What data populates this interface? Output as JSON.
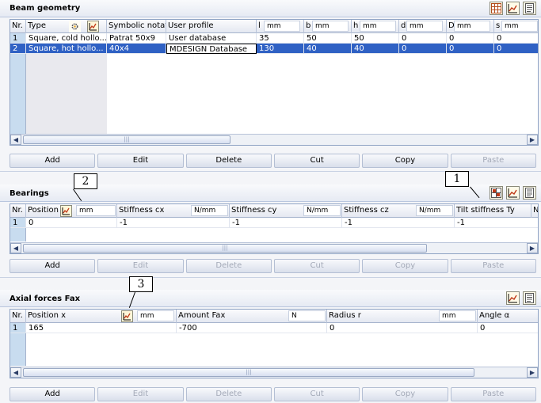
{
  "beam_geometry": {
    "title": "Beam geometry",
    "columns": {
      "nr": "Nr.",
      "type": "Type",
      "symbolic": "Symbolic notati",
      "user_profile": "User profile",
      "l": "l",
      "l_unit": "mm",
      "b": "b",
      "b_unit": "mm",
      "h": "h",
      "h_unit": "mm",
      "d": "d",
      "d_unit": "mm",
      "D": "D",
      "D_unit": "mm",
      "s": "s",
      "s_unit": "mm"
    },
    "rows": [
      {
        "nr": "1",
        "type": "Square, cold hollo...",
        "symbolic": "Patrat 50x9",
        "user_profile": "User database",
        "l": "35",
        "b": "50",
        "h": "50",
        "d": "0",
        "D": "0",
        "s": "0"
      },
      {
        "nr": "2",
        "type": "Square, hot hollo...",
        "symbolic": "40x4",
        "user_profile": "MDESIGN Database",
        "l": "130",
        "b": "40",
        "h": "40",
        "d": "0",
        "D": "0",
        "s": "0"
      }
    ],
    "buttons": {
      "add": "Add",
      "edit": "Edit",
      "delete": "Delete",
      "cut": "Cut",
      "copy": "Copy",
      "paste": "Paste"
    }
  },
  "bearings": {
    "title": "Bearings",
    "columns": {
      "nr": "Nr.",
      "position": "Position",
      "position_unit": "mm",
      "cx": "Stiffness cx",
      "cx_unit": "N/mm",
      "cy": "Stiffness cy",
      "cy_unit": "N/mm",
      "cz": "Stiffness cz",
      "cz_unit": "N/mm",
      "ty": "Tilt stiffness Ty",
      "ty_unit": "N"
    },
    "rows": [
      {
        "nr": "1",
        "position": "0",
        "cx": "-1",
        "cy": "-1",
        "cz": "-1",
        "ty": "-1"
      }
    ],
    "buttons": {
      "add": "Add",
      "edit": "Edit",
      "delete": "Delete",
      "cut": "Cut",
      "copy": "Copy",
      "paste": "Paste"
    }
  },
  "axial_forces": {
    "title": "Axial forces Fax",
    "columns": {
      "nr": "Nr.",
      "position": "Position x",
      "position_unit": "mm",
      "amount": "Amount Fax",
      "amount_unit": "N",
      "radius": "Radius r",
      "radius_unit": "mm",
      "angle": "Angle α"
    },
    "rows": [
      {
        "nr": "1",
        "position": "165",
        "amount": "-700",
        "radius": "0",
        "angle": "0"
      }
    ],
    "buttons": {
      "add": "Add",
      "edit": "Edit",
      "delete": "Delete",
      "cut": "Cut",
      "copy": "Copy",
      "paste": "Paste"
    }
  },
  "callouts": {
    "one": "1",
    "two": "2",
    "three": "3"
  },
  "colors": {
    "selection": "#2f61c4",
    "row_header": "#c8dcef",
    "icon_bg": "#fff6d8"
  }
}
